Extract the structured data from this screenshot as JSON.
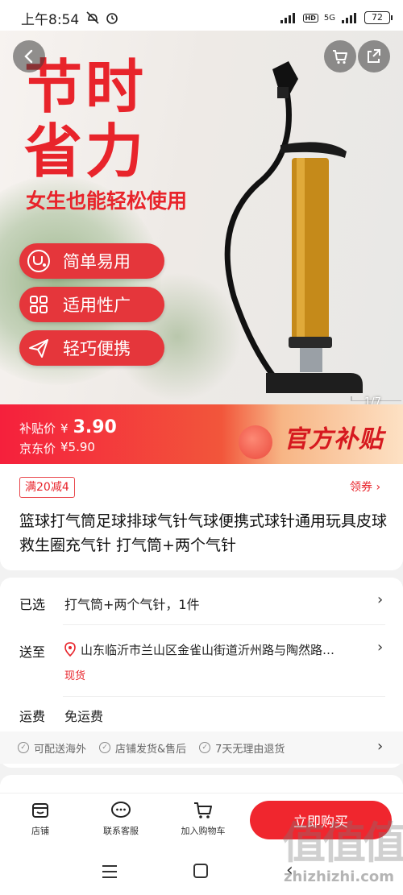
{
  "status_bar": {
    "time": "上午8:54",
    "network": "5G",
    "battery": "72"
  },
  "hero": {
    "headline_line1": "节时",
    "headline_line2": "省力",
    "subheadline": "女生也能轻松使用",
    "features": [
      {
        "label": "简单易用",
        "icon": "stethoscope-icon"
      },
      {
        "label": "适用性广",
        "icon": "grid-icon"
      },
      {
        "label": "轻巧便携",
        "icon": "paper-plane-icon"
      }
    ],
    "pager": "1/7"
  },
  "price": {
    "subsidy_label": "补贴价",
    "currency": "¥",
    "subsidy_price": "3.90",
    "jd_label": "京东价",
    "jd_price": "¥5.90",
    "badge": "官方补贴"
  },
  "promo": {
    "tag": "满20减4",
    "coupon": "领券 ›"
  },
  "product_title": "篮球打气筒足球排球气针气球便携式球针通用玩具皮球救生圈充气针 打气筒+两个气针",
  "selection": {
    "selected_label": "已选",
    "selected_value": "打气筒+两个气针，1件",
    "ship_label": "送至",
    "ship_address": "山东临沂市兰山区金雀山街道沂州路与陶然路…",
    "stock": "现货",
    "freight_label": "运费",
    "freight_value": "免运费"
  },
  "guarantees": [
    "可配送海外",
    "店铺发货&售后",
    "7天无理由退货"
  ],
  "action_bar": {
    "store": "店铺",
    "service": "联系客服",
    "cart": "加入购物车",
    "buy": "立即购买"
  },
  "watermark": {
    "logo": "值值值",
    "url": "zhizhizhi.com"
  }
}
